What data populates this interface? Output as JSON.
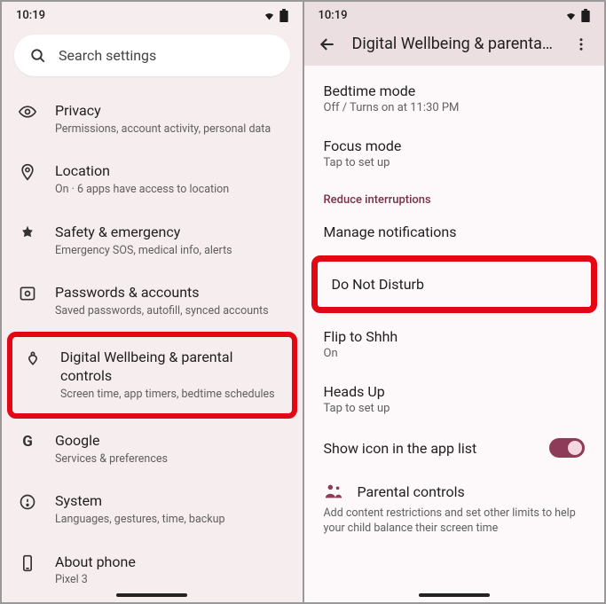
{
  "status": {
    "time": "10:19"
  },
  "left": {
    "search_placeholder": "Search settings",
    "items": [
      {
        "title": "Privacy",
        "sub": "Permissions, account activity, personal data"
      },
      {
        "title": "Location",
        "sub": "On · 6 apps have access to location"
      },
      {
        "title": "Safety & emergency",
        "sub": "Emergency SOS, medical info, alerts"
      },
      {
        "title": "Passwords & accounts",
        "sub": "Saved passwords, autofill, synced accounts"
      },
      {
        "title": "Digital Wellbeing & parental controls",
        "sub": "Screen time, app timers, bedtime schedules"
      },
      {
        "title": "Google",
        "sub": "Services & preferences"
      },
      {
        "title": "System",
        "sub": "Languages, gestures, time, backup"
      },
      {
        "title": "About phone",
        "sub": "Pixel 3"
      }
    ]
  },
  "right": {
    "appbar_title": "Digital Wellbeing & parental...",
    "rows": {
      "bedtime": {
        "title": "Bedtime mode",
        "sub": "Off / Turns on at 11:30 PM"
      },
      "focus": {
        "title": "Focus mode",
        "sub": "Tap to set up"
      },
      "section_label": "Reduce interruptions",
      "manage": {
        "title": "Manage notifications"
      },
      "dnd": {
        "title": "Do Not Disturb"
      },
      "flip": {
        "title": "Flip to Shhh",
        "sub": "On"
      },
      "headsup": {
        "title": "Heads Up",
        "sub": "Tap to set up"
      },
      "showicon": {
        "title": "Show icon in the app list"
      },
      "parental": {
        "title": "Parental controls",
        "desc": "Add content restrictions and set other limits to help your child balance their screen time"
      }
    }
  }
}
